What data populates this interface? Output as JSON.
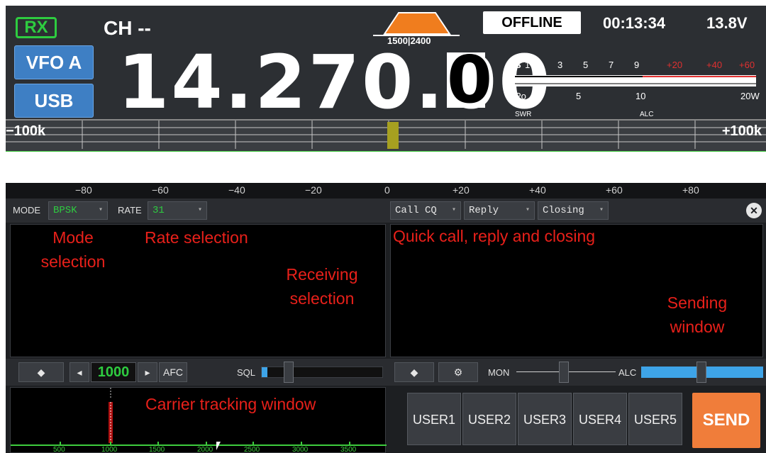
{
  "radio": {
    "rx_badge": "RX",
    "channel": "CH --",
    "vfo": "VFO A",
    "mode": "USB",
    "filter_low": "1500",
    "filter_high": "2400",
    "frequency_main": "14.270.00",
    "frequency_cursor_digit": "0",
    "status": "OFFLINE",
    "clock": "00:13:34",
    "voltage": "13.8V",
    "s_meter_labels": [
      "S",
      "1",
      "3",
      "5",
      "7",
      "9"
    ],
    "s_meter_red_labels": [
      "+20",
      "+40",
      "+60"
    ],
    "po_labels": [
      "Po",
      "5",
      "10",
      "20W"
    ],
    "swr_label": "SWR",
    "alc_label": "ALC",
    "span_left": "−100k",
    "span_right": "+100k"
  },
  "scale_ticks": [
    "−80",
    "−60",
    "−40",
    "−20",
    "0",
    "+20",
    "+40",
    "+60",
    "+80"
  ],
  "psk": {
    "mode_label": "MODE",
    "mode_value": "BPSK",
    "rate_label": "RATE",
    "rate_value": "31",
    "call_cq": "Call CQ",
    "reply": "Reply",
    "closing": "Closing",
    "afc_value": "1000",
    "afc_label": "AFC",
    "sql_label": "SQL",
    "mon_label": "MON",
    "alc_label": "ALC",
    "user_buttons": [
      "USER1",
      "USER2",
      "USER3",
      "USER4",
      "USER5"
    ],
    "send": "SEND",
    "waterfall_ticks": [
      "500",
      "1000",
      "1500",
      "2000",
      "2500",
      "3000",
      "3500"
    ]
  },
  "annotations": {
    "mode": "Mode\nselection",
    "rate": "Rate selection",
    "quick": "Quick call, reply and closing",
    "receiving": "Receiving\nselection",
    "sending": "Sending\nwindow",
    "carrier": "Carrier tracking window"
  },
  "colors": {
    "accent_green": "#2ecc40",
    "vfo_blue": "#3e7fc4",
    "send_orange": "#f07d3a",
    "annotation_red": "#e8201a",
    "alc_blue": "#3ea4e8"
  }
}
